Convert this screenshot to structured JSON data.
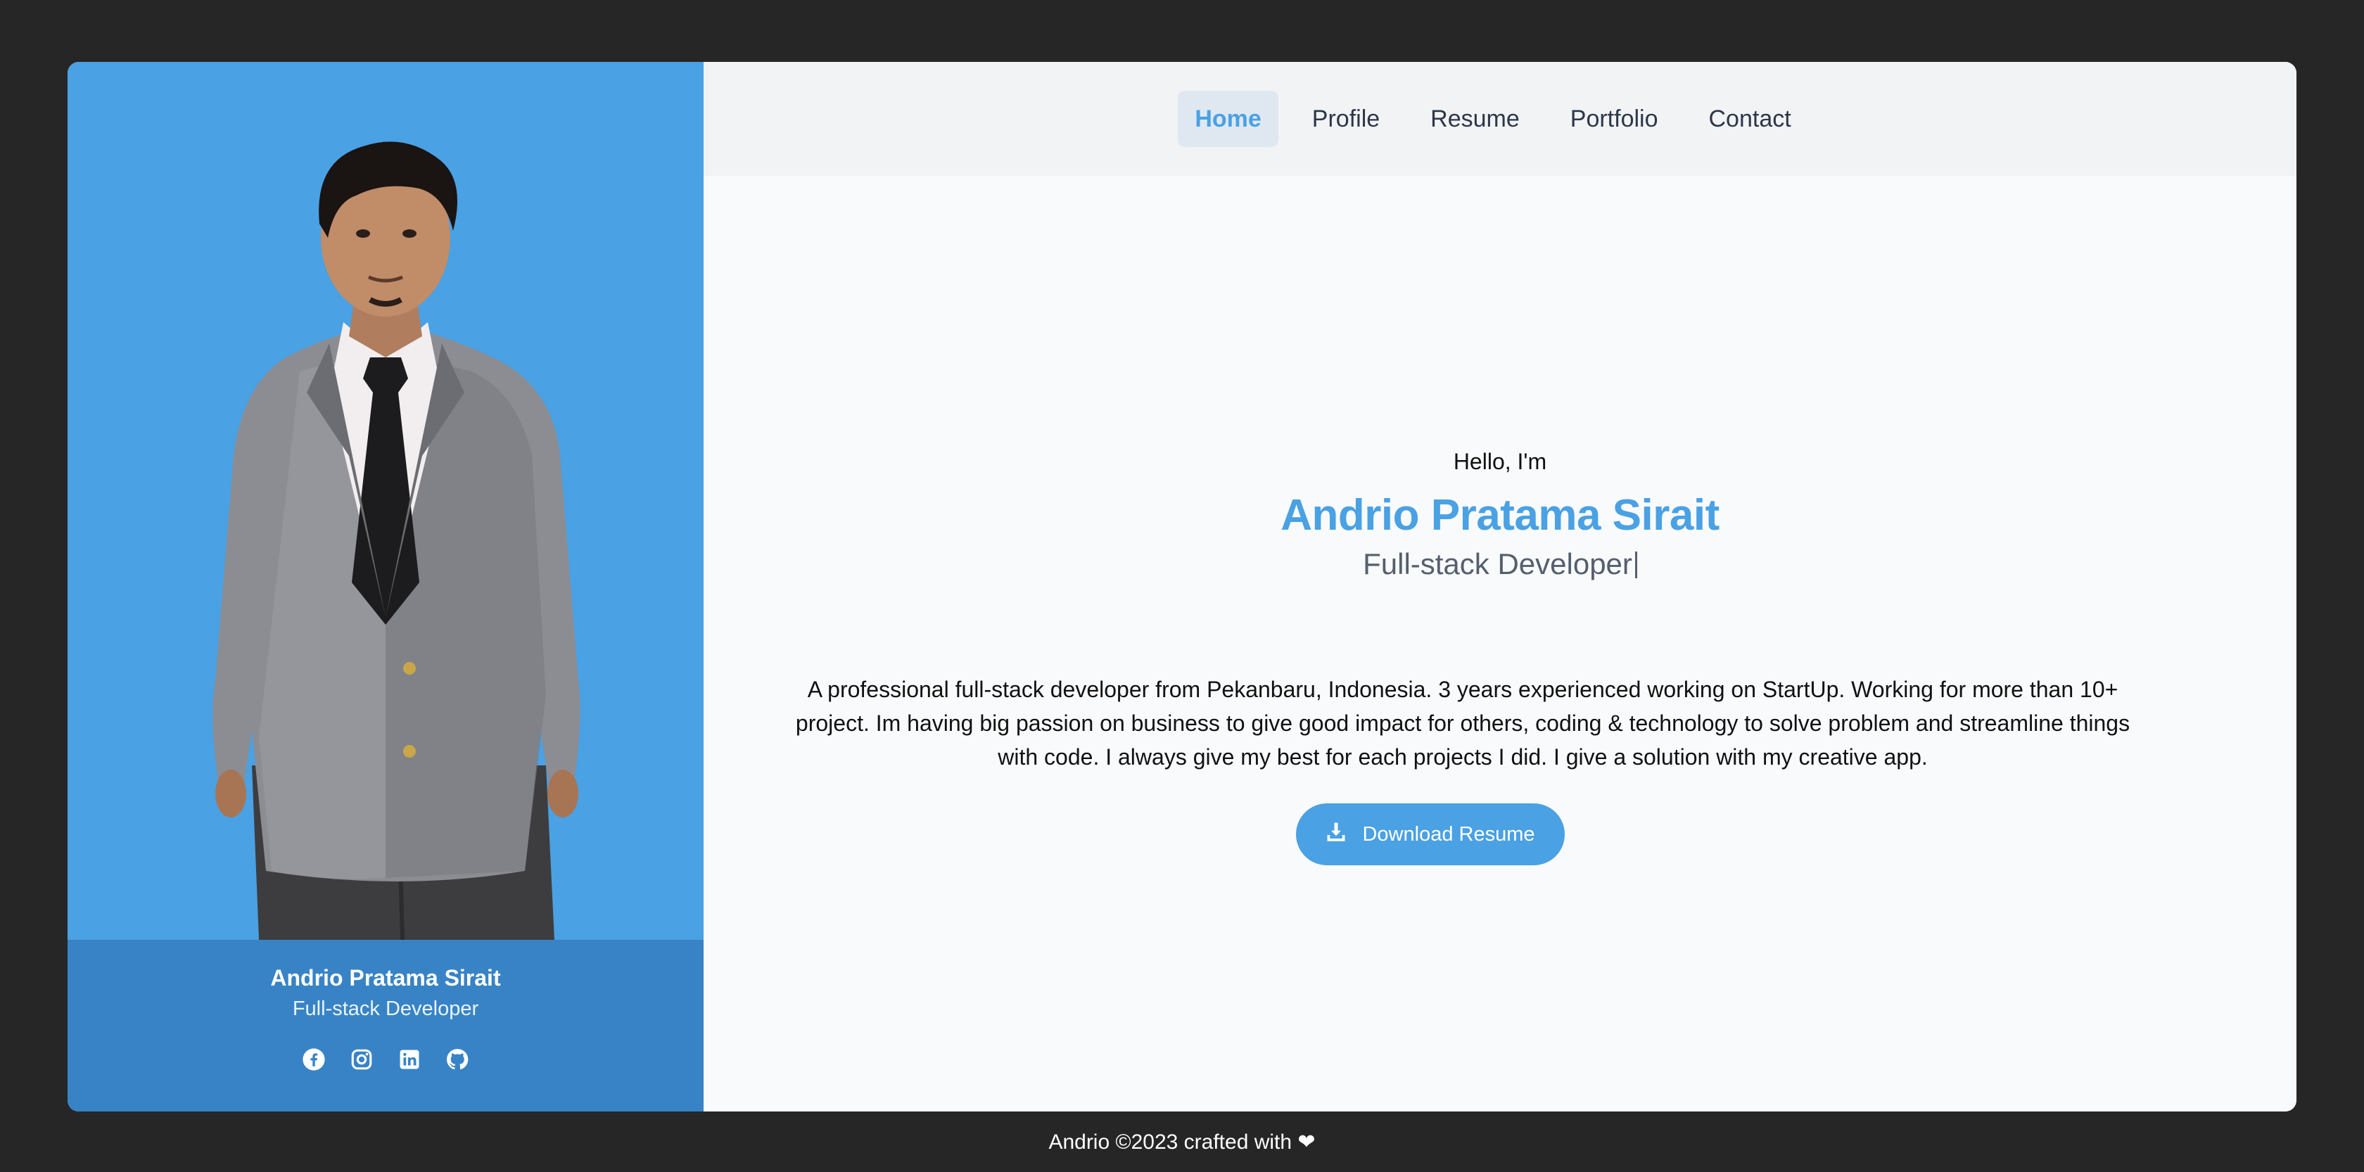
{
  "profile_card": {
    "name": "Andrio Pratama Sirait",
    "role": "Full-stack Developer",
    "socials": [
      {
        "icon": "facebook-icon"
      },
      {
        "icon": "instagram-icon"
      },
      {
        "icon": "linkedin-icon"
      },
      {
        "icon": "github-icon"
      }
    ]
  },
  "nav": {
    "items": [
      {
        "label": "Home",
        "active": true
      },
      {
        "label": "Profile",
        "active": false
      },
      {
        "label": "Resume",
        "active": false
      },
      {
        "label": "Portfolio",
        "active": false
      },
      {
        "label": "Contact",
        "active": false
      }
    ]
  },
  "hero": {
    "greeting": "Hello, I'm",
    "name": "Andrio Pratama Sirait",
    "role": "Full-stack Developer",
    "bio": "A professional full-stack developer from Pekanbaru, Indonesia. 3 years experienced working on StartUp. Working for more than 10+ project. Im having big passion on business to give good impact for others, coding & technology to solve problem and streamline things with code. I always give my best for each projects I did. I give a solution with my creative app."
  },
  "actions": {
    "download_label": "Download Resume",
    "download_icon": "download-icon"
  },
  "footer": {
    "text": "Andrio ©2023 crafted with ❤"
  },
  "colors": {
    "accent": "#4aa1e3",
    "accent_dark": "#3883c5",
    "page_bg": "#262626",
    "content_bg": "#f8fafc",
    "nav_bg": "#f1f3f5"
  }
}
